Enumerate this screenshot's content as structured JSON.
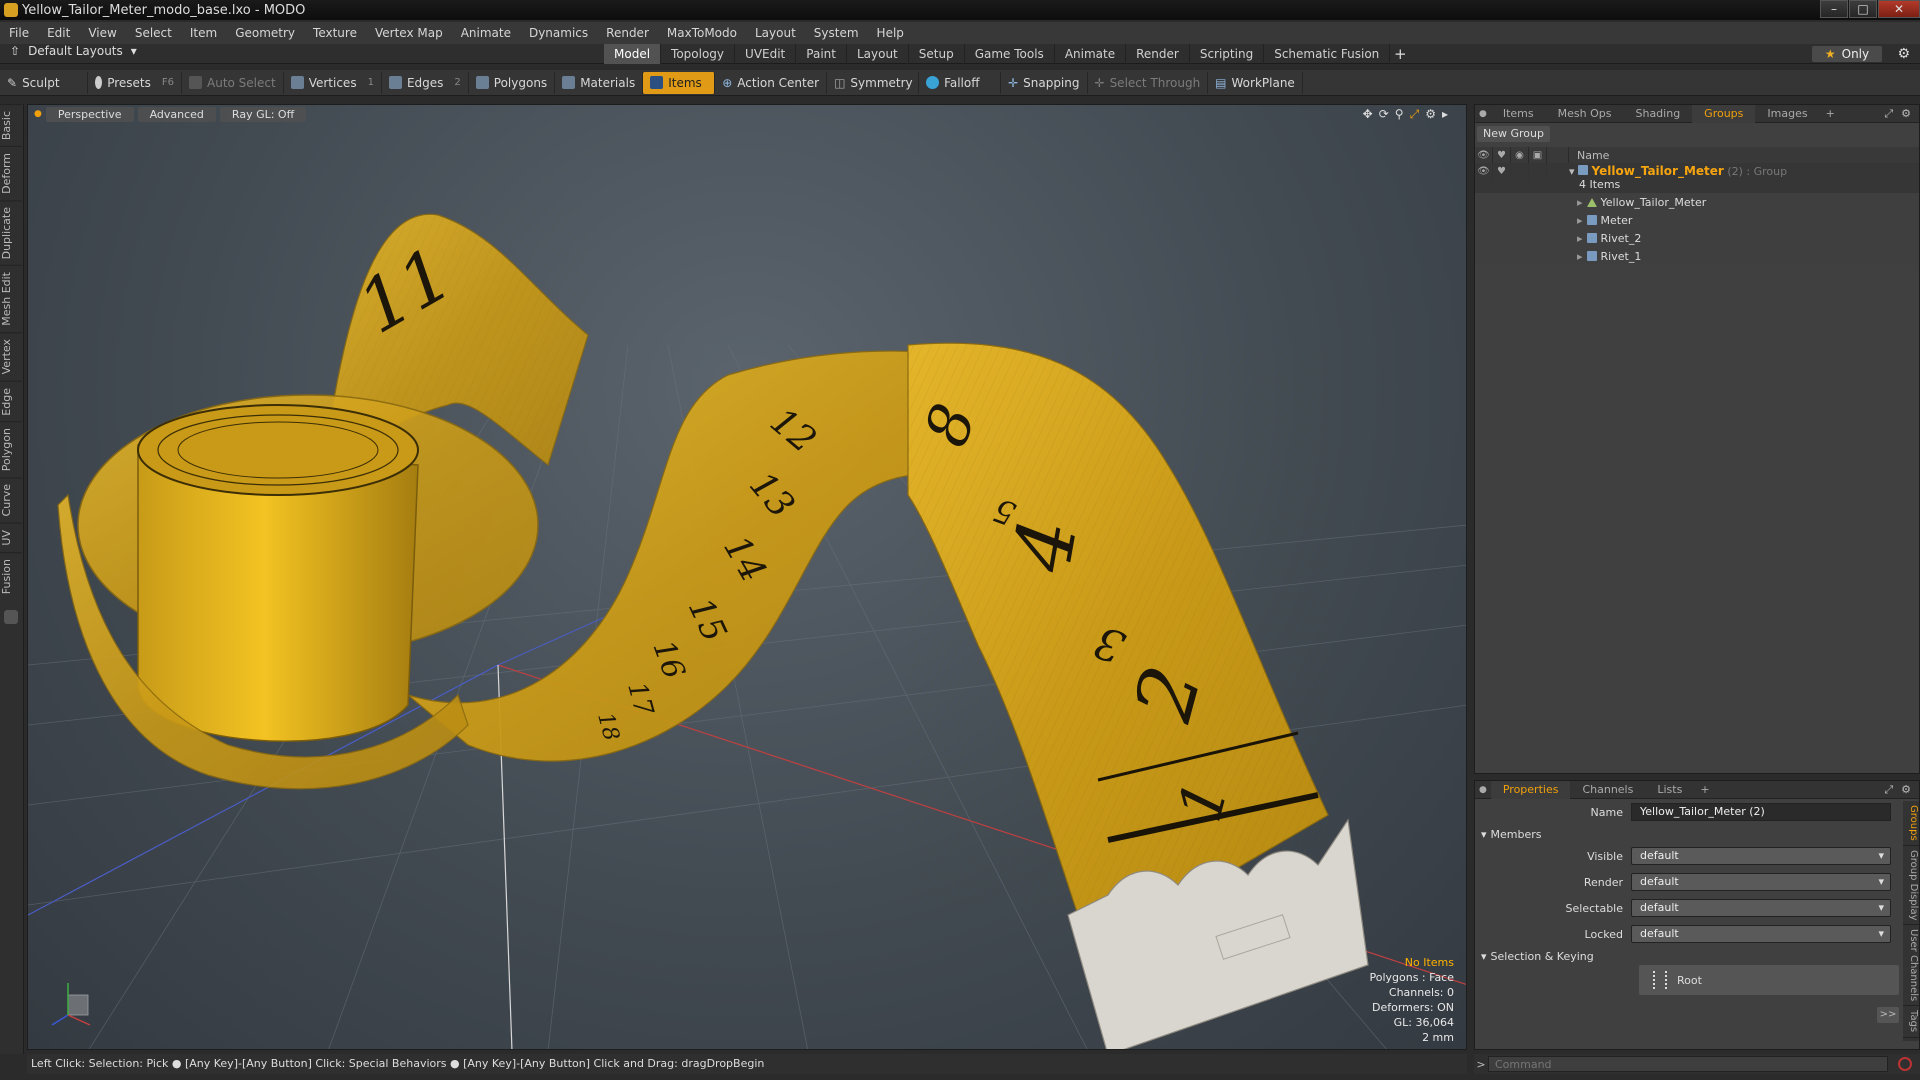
{
  "window": {
    "title": "Yellow_Tailor_Meter_modo_base.lxo - MODO",
    "controls": [
      "–",
      "□",
      "✕"
    ]
  },
  "menubar": [
    "File",
    "Edit",
    "View",
    "Select",
    "Item",
    "Geometry",
    "Texture",
    "Vertex Map",
    "Animate",
    "Dynamics",
    "Render",
    "MaxToModo",
    "Layout",
    "System",
    "Help"
  ],
  "layoutbar": {
    "layout_select": "Default Layouts",
    "tabs": [
      "Model",
      "Topology",
      "UVEdit",
      "Paint",
      "Layout",
      "Setup",
      "Game Tools",
      "Animate",
      "Render",
      "Scripting",
      "Schematic Fusion"
    ],
    "active_tab": "Model",
    "only_label": "Only"
  },
  "toolbar": {
    "sculpt": "Sculpt",
    "presets": "Presets",
    "presets_key": "F6",
    "auto_select": "Auto Select",
    "vertices": "Vertices",
    "vertices_key": "1",
    "edges": "Edges",
    "edges_key": "2",
    "polygons": "Polygons",
    "materials": "Materials",
    "items": "Items",
    "action_center": "Action Center",
    "symmetry": "Symmetry",
    "falloff": "Falloff",
    "snapping": "Snapping",
    "select_through": "Select Through",
    "workplane": "WorkPlane"
  },
  "left_tabs": [
    "Basic",
    "Deform",
    "Duplicate",
    "Mesh Edit",
    "Vertex",
    "Edge",
    "Polygon",
    "Curve",
    "UV",
    "Fusion"
  ],
  "viewport": {
    "view_mode": "Perspective",
    "shading": "Advanced",
    "raygl": "Ray GL: Off",
    "info": {
      "selection": "No Items",
      "polygons": "Polygons : Face",
      "channels": "Channels: 0",
      "deformers": "Deformers: ON",
      "gl": "GL: 36,064",
      "unit": "2 mm"
    },
    "tape_numbers": [
      "11",
      "12",
      "13",
      "14",
      "15",
      "16",
      "17",
      "18",
      "8",
      "5",
      "4",
      "3",
      "2",
      "1"
    ]
  },
  "statusbar": {
    "text": "Left Click: Selection: Pick ●  [Any Key]-[Any Button] Click: Special Behaviors ●  [Any Key]-[Any Button] Click and Drag: dragDropBegin"
  },
  "top_panel": {
    "tabs": [
      "Items",
      "Mesh Ops",
      "Shading",
      "Groups",
      "Images"
    ],
    "active_tab": "Groups",
    "new_group": "New Group",
    "name_col": "Name",
    "group": {
      "name": "Yellow_Tailor_Meter",
      "suffix": "(2) : Group",
      "count": "4 Items"
    },
    "items": [
      "Yellow_Tailor_Meter",
      "Meter",
      "Rivet_2",
      "Rivet_1"
    ]
  },
  "bottom_panel": {
    "tabs": [
      "Properties",
      "Channels",
      "Lists"
    ],
    "active_tab": "Properties",
    "name_label": "Name",
    "name_value": "Yellow_Tailor_Meter (2)",
    "members_section": "Members",
    "visible_label": "Visible",
    "visible_value": "default",
    "render_label": "Render",
    "render_value": "default",
    "selectable_label": "Selectable",
    "selectable_value": "default",
    "locked_label": "Locked",
    "locked_value": "default",
    "keying_section": "Selection & Keying",
    "root_label": "Root",
    "more": ">>",
    "side_tabs": [
      "Groups",
      "Group Display",
      "User Channels",
      "Tags"
    ]
  },
  "commandbar": {
    "prompt": ">",
    "placeholder": "Command"
  },
  "colors": {
    "accent": "#e09a16",
    "tape_yellow": "#d9ad1f",
    "viewport_bg": "#4b535b"
  }
}
